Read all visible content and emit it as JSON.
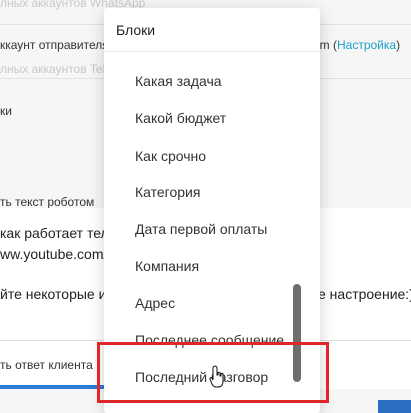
{
  "background": {
    "line1": "лных аккаунтов WhatsApp",
    "line2_left": "ккаунт отправителя",
    "line2_right_prefix": "am (",
    "line2_link": "Настройка",
    "line2_right_suffix": ")",
    "line3": "лных аккаунтов Tele",
    "line4": "ки",
    "line5": "ть текст роботом",
    "line6": "как работает тел",
    "line7": "ww.youtube.com/",
    "line8_left": "йте некоторые и",
    "line8_right": "е настроение:)",
    "bottom_input": "ть ответ клиента"
  },
  "dropdown": {
    "header": "Блоки",
    "items": [
      "Какая задача",
      "Какой бюджет",
      "Как срочно",
      "Категория",
      "Дата первой оплаты",
      "Компания",
      "Адрес",
      "Последнее сообщение",
      "Последний разговор"
    ]
  },
  "colors": {
    "link": "#1aa0c8",
    "highlight": "#e1262a",
    "accent": "#2c7bd6"
  }
}
